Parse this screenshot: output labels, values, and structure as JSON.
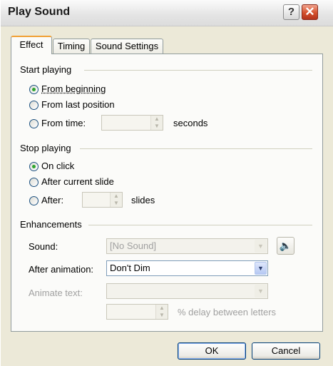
{
  "window": {
    "title": "Play Sound"
  },
  "titlebar": {
    "help_glyph": "?",
    "close_glyph": "✕"
  },
  "tabs": [
    {
      "label": "Effect",
      "active": true
    },
    {
      "label": "Timing",
      "active": false
    },
    {
      "label": "Sound Settings",
      "active": false
    }
  ],
  "start_playing": {
    "heading": "Start playing",
    "options": [
      {
        "label": "From beginning",
        "selected": true
      },
      {
        "label": "From last position",
        "selected": false
      },
      {
        "label": "From time:",
        "selected": false
      }
    ],
    "time_value": "",
    "seconds_label": "seconds"
  },
  "stop_playing": {
    "heading": "Stop playing",
    "options": [
      {
        "label": "On click",
        "selected": true
      },
      {
        "label": "After current slide",
        "selected": false
      },
      {
        "label": "After:",
        "selected": false
      }
    ],
    "slides_value": "",
    "slides_label": "slides"
  },
  "enhancements": {
    "heading": "Enhancements",
    "sound_label": "Sound:",
    "sound_value": "[No Sound]",
    "after_animation_label": "After animation:",
    "after_animation_value": "Don't Dim",
    "animate_text_label": "Animate text:",
    "animate_text_value": "",
    "delay_value": "",
    "delay_label": "% delay between letters",
    "speaker_icon": "speaker-icon"
  },
  "buttons": {
    "ok": "OK",
    "cancel": "Cancel"
  },
  "colors": {
    "accent_tab": "#f1a035",
    "radio_dot": "#2fa52f",
    "close": "#d4502c"
  }
}
